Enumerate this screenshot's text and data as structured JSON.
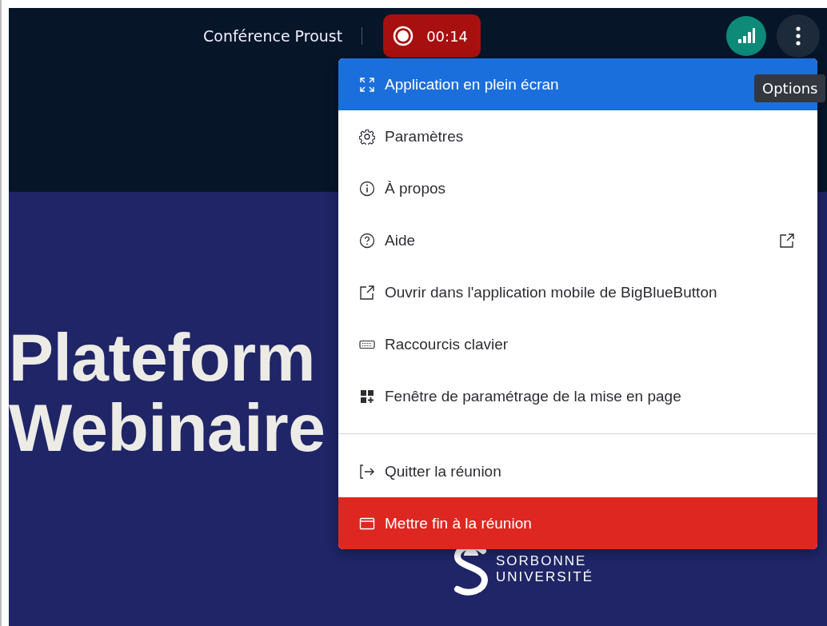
{
  "top_bar": {
    "title": "Conférence Proust",
    "recording": {
      "on": true,
      "time": "00:14"
    }
  },
  "options_tooltip": "Options",
  "menu": {
    "groups": [
      [
        {
          "label": "Application en plein écran",
          "selected": true,
          "kind": "normal",
          "external": false
        },
        {
          "label": "Paramètres",
          "selected": false,
          "kind": "normal",
          "external": false
        },
        {
          "label": "À propos",
          "selected": false,
          "kind": "normal",
          "external": false
        },
        {
          "label": "Aide",
          "selected": false,
          "kind": "normal",
          "external": true
        },
        {
          "label": "Ouvrir dans l'application mobile de BigBlueButton",
          "selected": false,
          "kind": "normal",
          "external": false
        },
        {
          "label": "Raccourcis clavier",
          "selected": false,
          "kind": "normal",
          "external": false
        },
        {
          "label": "Fenêtre de paramétrage de la mise en page",
          "selected": false,
          "kind": "normal",
          "external": false
        }
      ],
      [
        {
          "label": "Quitter la réunion",
          "selected": false,
          "kind": "normal",
          "external": false
        },
        {
          "label": "Mettre fin à la réunion",
          "selected": false,
          "kind": "danger",
          "external": false
        }
      ]
    ]
  },
  "slide": {
    "title_lines": [
      "Plateform",
      "Webinaire"
    ],
    "logo_lines": [
      "SORBONNE",
      "UNIVERSITÉ"
    ]
  }
}
